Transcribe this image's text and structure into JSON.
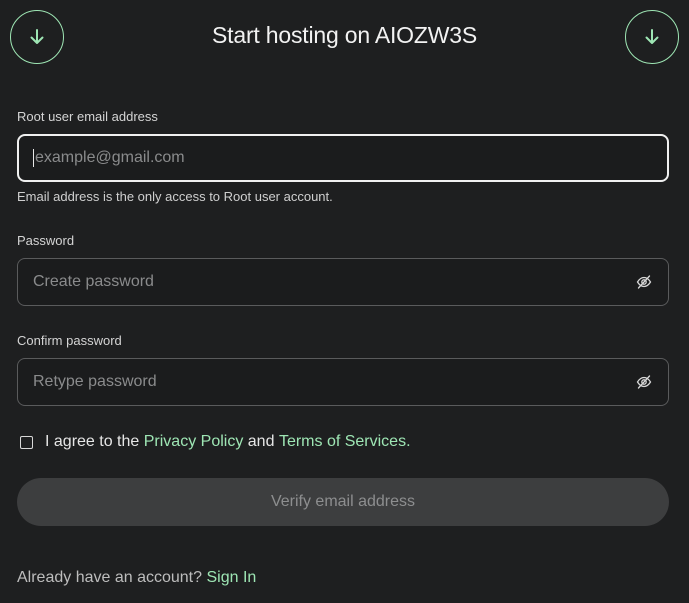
{
  "header": {
    "title": "Start hosting on AIOZW3S",
    "left_icon": "arrow-down-icon",
    "right_icon": "arrow-down-icon",
    "accent_color": "#9ee6b4"
  },
  "email": {
    "label": "Root user email address",
    "placeholder": "example@gmail.com",
    "value": "",
    "helper": "Email address is the only access to Root user account."
  },
  "password": {
    "label": "Password",
    "placeholder": "Create password",
    "value": "",
    "icon": "eye-off-icon"
  },
  "confirm_password": {
    "label": "Confirm password",
    "placeholder": "Retype password",
    "value": "",
    "icon": "eye-off-icon"
  },
  "agreement": {
    "checked": false,
    "prefix": "I agree to the",
    "privacy_link": "Privacy Policy",
    "conjunction": "and",
    "terms_link": "Terms of Services."
  },
  "verify_button": {
    "label": "Verify email address"
  },
  "footer": {
    "prompt": "Already have an account?",
    "signin_link": "Sign In"
  }
}
